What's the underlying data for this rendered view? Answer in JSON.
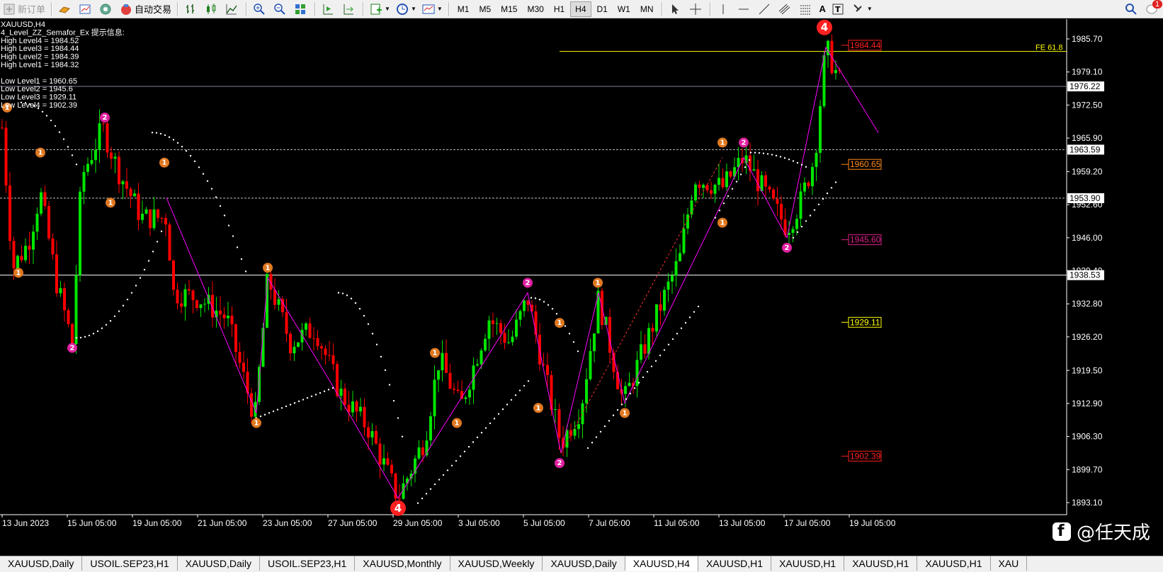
{
  "toolbar": {
    "new_order": "新订单",
    "auto_trade": "自动交易",
    "timeframes": [
      "M1",
      "M5",
      "M15",
      "M30",
      "H1",
      "H4",
      "D1",
      "W1",
      "MN"
    ],
    "active_timeframe": "H4",
    "notification_count": "1"
  },
  "chart": {
    "symbol": "XAUUSD,H4",
    "indicator_title": "4_Level_ZZ_Semafor_Ex 提示信息:",
    "info_lines": [
      "High Level4 = 1984.52",
      "High Level3 = 1984.44",
      "High Level2 = 1984.39",
      "High Level1 = 1984.32",
      "",
      "Low Level1 = 1960.65",
      "Low Level2 = 1945.6",
      "Low Level3 = 1929.11",
      "Low Level4 = 1902.39"
    ],
    "price_ticks": [
      "1985.70",
      "1979.10",
      "1972.50",
      "1965.90",
      "1959.20",
      "1952.60",
      "1946.00",
      "1939.40",
      "1932.80",
      "1926.20",
      "1919.50",
      "1912.90",
      "1906.30",
      "1899.70",
      "1893.10"
    ],
    "time_labels": [
      "13 Jun 2023",
      "15 Jun 05:00",
      "19 Jun 05:00",
      "21 Jun 05:00",
      "23 Jun 05:00",
      "27 Jun 05:00",
      "29 Jun 05:00",
      "3 Jul 05:00",
      "5 Jul 05:00",
      "7 Jul 05:00",
      "11 Jul 05:00",
      "13 Jul 05:00",
      "17 Jul 05:00",
      "19 Jul 05:00"
    ],
    "price_tags": [
      {
        "text": "1976.22",
        "price": 1976.22
      },
      {
        "text": "1963.59",
        "price": 1963.59
      },
      {
        "text": "1953.90",
        "price": 1953.9
      },
      {
        "text": "1938.53",
        "price": 1938.53
      }
    ],
    "level_labels": [
      {
        "text": "1984.44",
        "price": 1984.44,
        "color": "#ff2020"
      },
      {
        "text": "1960.65",
        "price": 1960.65,
        "color": "#ff8c1a"
      },
      {
        "text": "1945.60",
        "price": 1945.6,
        "color": "#e0208a"
      },
      {
        "text": "1929.11",
        "price": 1929.11,
        "color": "#ffff00"
      },
      {
        "text": "1902.39",
        "price": 1902.39,
        "color": "#ff2020"
      }
    ],
    "fe_label": "FE 61.8",
    "colors": {
      "up": "#00e600",
      "down": "#ff0000",
      "zigzag": "#ff00ff",
      "fib": "#ffff00",
      "sar": "#ffffff"
    }
  },
  "tabs": [
    "XAUUSD,Daily",
    "USOIL.SEP23,H1",
    "XAUUSD,Daily",
    "USOIL.SEP23,H1",
    "XAUUSD,Monthly",
    "XAUUSD,Weekly",
    "XAUUSD,Daily",
    "XAUUSD,H4",
    "XAUUSD,H1",
    "XAUUSD,H1",
    "XAUUSD,H1",
    "XAUUSD,H1",
    "XAU"
  ],
  "active_tab": 7,
  "watermark": "@任天成"
}
